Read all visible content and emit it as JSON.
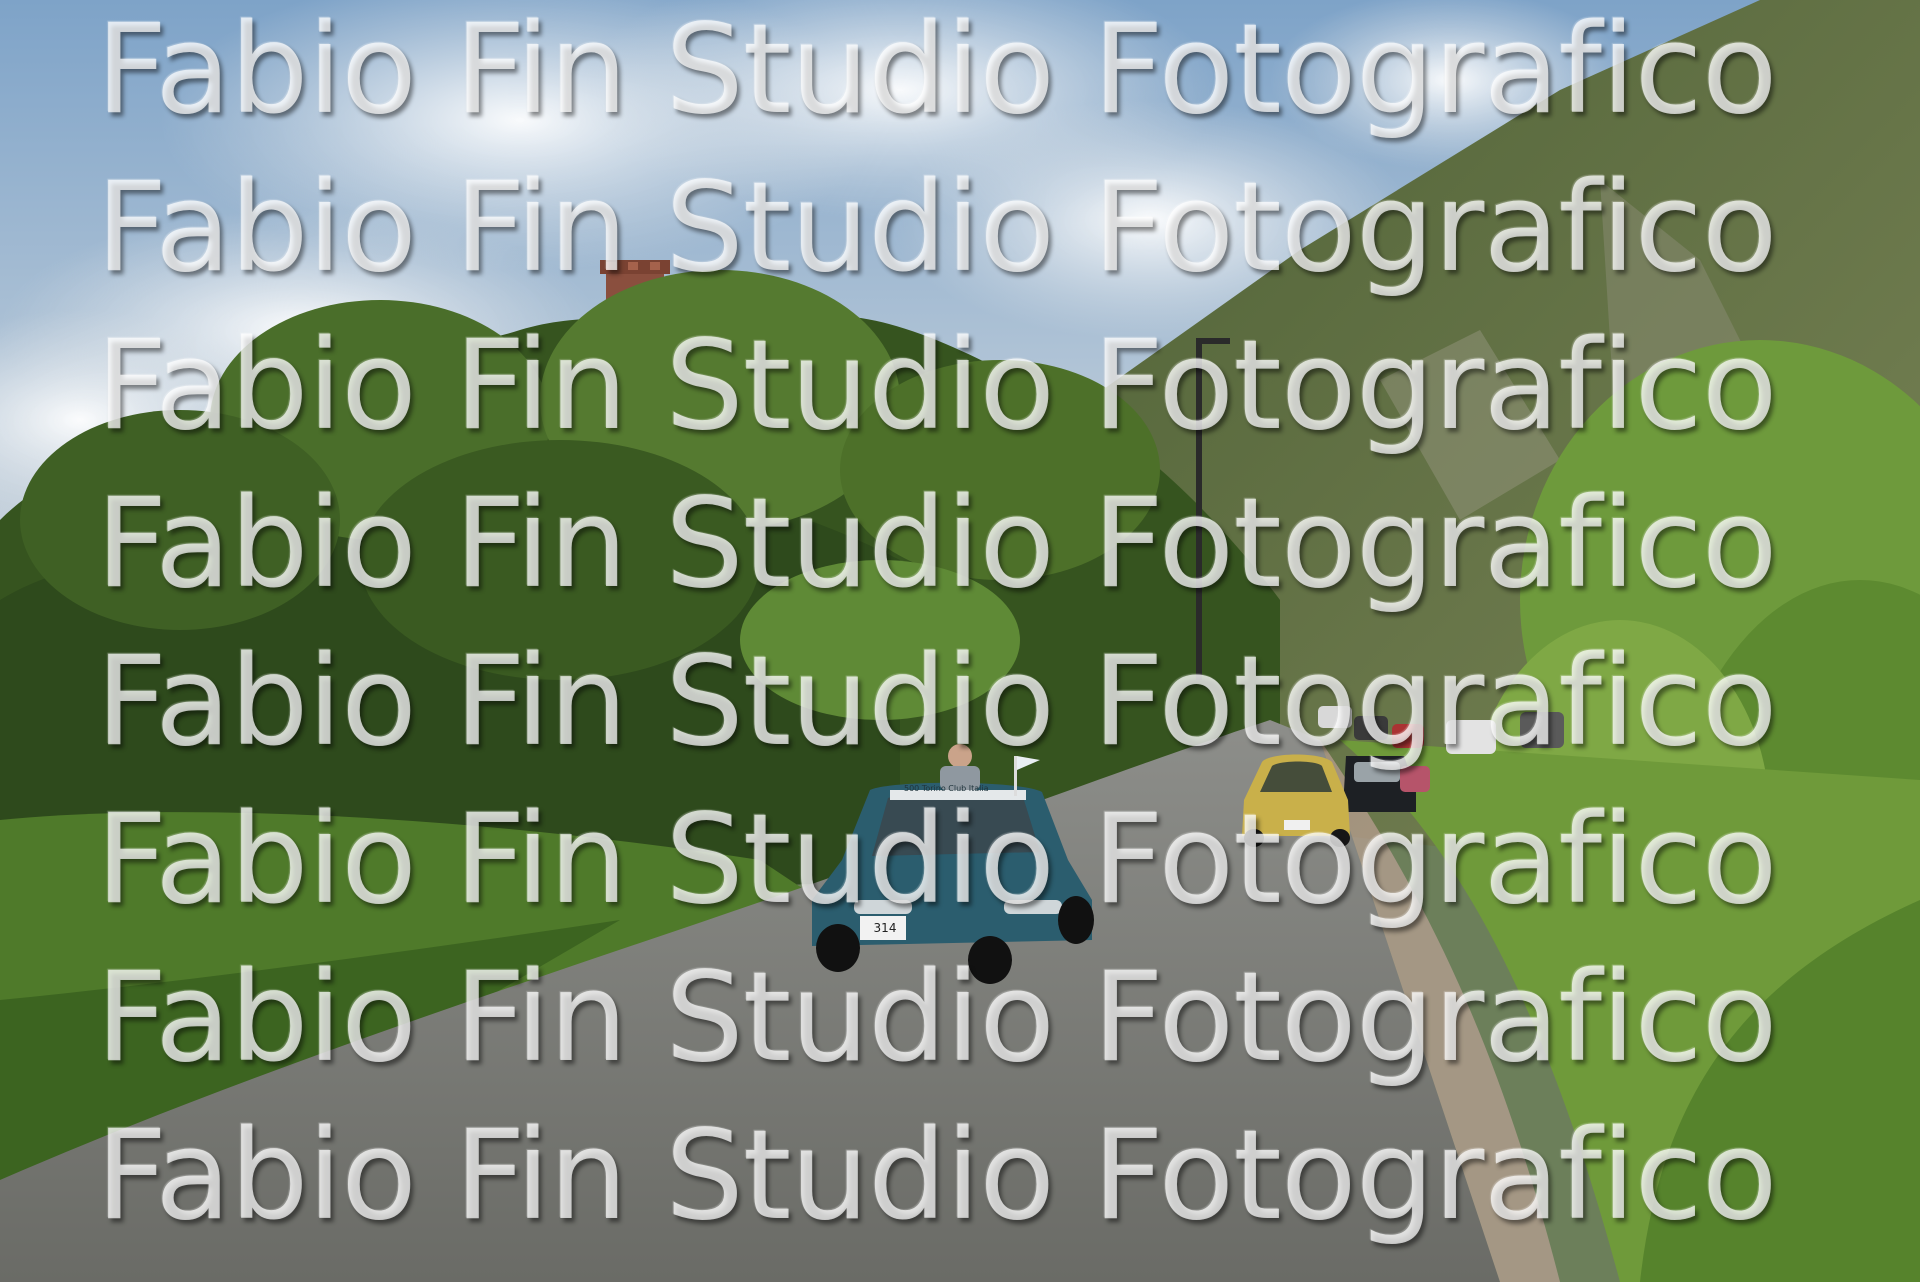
{
  "watermark": {
    "lines": [
      "Fabio Fin Studio Fotografico",
      "Fabio Fin Studio Fotografico",
      "Fabio Fin Studio Fotografico",
      "Fabio Fin Studio Fotografico",
      "Fabio Fin Studio Fotografico",
      "Fabio Fin Studio Fotografico",
      "Fabio Fin Studio Fotografico",
      "Fabio Fin Studio Fotografico"
    ]
  },
  "scene": {
    "subjects": [
      "sky-with-clouds",
      "brick-tower",
      "forested-hillside",
      "rocky-mountain",
      "road",
      "blue-fiat-500",
      "yellow-fiat-500",
      "classic-car-convoy",
      "street-lamp"
    ],
    "colors": {
      "sky": "#8fb0cf",
      "cloud": "#eef1f4",
      "foliage_dark": "#2e4a1c",
      "foliage_light": "#7fa845",
      "mountain": "#5d6e45",
      "road": "#7b7c78",
      "blue_car": "#2b5d6e",
      "yellow_car": "#c9b04a",
      "tower": "#8a4f3e"
    }
  },
  "car_plate_text": "500 Torino Club Italia",
  "car_number": "314"
}
